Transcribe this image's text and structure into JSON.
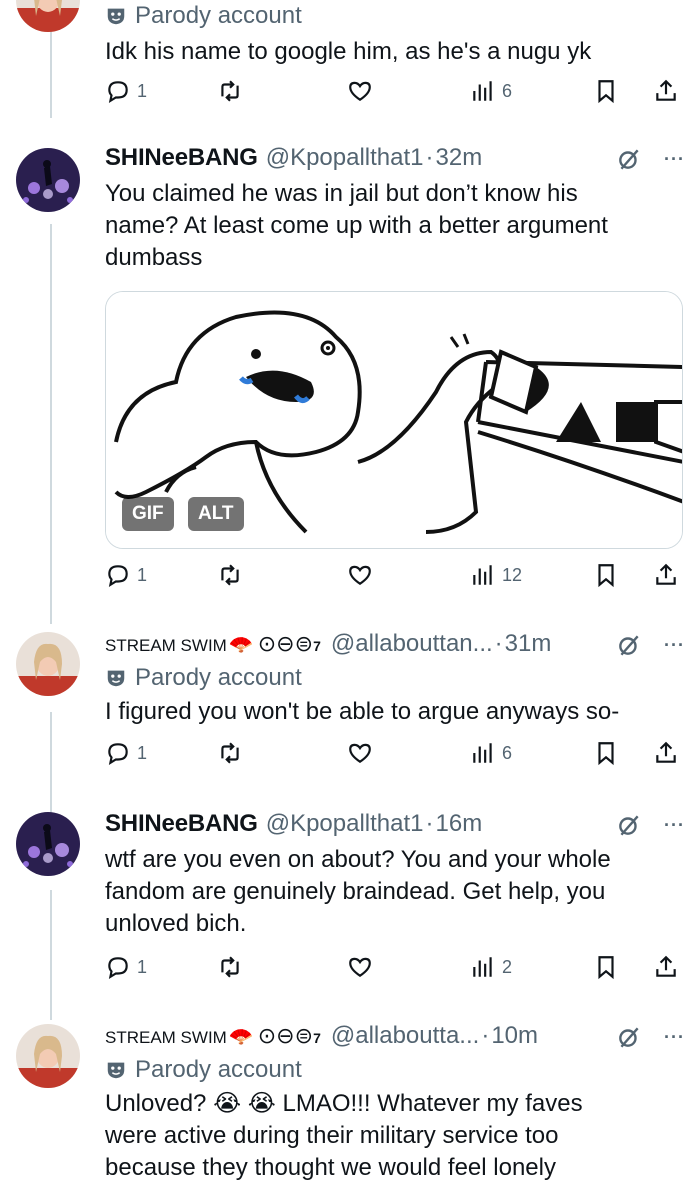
{
  "tweets": [
    {
      "parody_label": "Parody account",
      "text": "Idk his name to google him, as he's a nugu yk",
      "replies": "1",
      "retweets": "",
      "likes": "",
      "views": "6"
    },
    {
      "display_name": "SHINeeBANG",
      "handle": "@Kpopallthat1",
      "separator": "·",
      "time": "32m",
      "lines": [
        "You claimed he was in jail but don’t know his",
        "name? At least come up with a better argument",
        "dumbass"
      ],
      "media": {
        "gif_badge": "GIF",
        "alt_badge": "ALT"
      },
      "replies": "1",
      "retweets": "",
      "likes": "",
      "views": "12"
    },
    {
      "display_name": "STREAM SWIM",
      "fan_emoji": "🪭",
      "circles": "⊙⊖⊜",
      "superscript": "7",
      "handle": "@allabouttan...",
      "separator": "·",
      "time": "31m",
      "parody_label": "Parody account",
      "lines": [
        "I figured you won't be able to argue anyways so-"
      ],
      "replies": "1",
      "retweets": "",
      "likes": "",
      "views": "6"
    },
    {
      "display_name": "SHINeeBANG",
      "handle": "@Kpopallthat1",
      "separator": "·",
      "time": "16m",
      "lines": [
        "wtf are you even on about? You and your whole",
        "fandom are genuinely braindead. Get help, you",
        "unloved bich."
      ],
      "replies": "1",
      "retweets": "",
      "likes": "",
      "views": "2"
    },
    {
      "display_name": "STREAM SWIM",
      "fan_emoji": "🪭",
      "circles": "⊙⊖⊜",
      "superscript": "7",
      "handle": "@allaboutta...",
      "separator": "·",
      "time": "10m",
      "parody_label": "Parody account",
      "lines": [
        "Unloved? 😭 😭 LMAO!!! Whatever my faves",
        "were active during their military service too",
        "because they thought we would feel lonely"
      ],
      "replies": "",
      "retweets": "",
      "likes": "",
      "views": ""
    }
  ],
  "icons": {
    "reply": "reply-icon",
    "retweet": "retweet-icon",
    "like": "heart-icon",
    "views": "views-icon",
    "bookmark": "bookmark-icon",
    "share": "share-icon",
    "grok": "grok-icon",
    "more": "more-icon",
    "parody": "mask-icon"
  },
  "colors": {
    "text": "#0f1419",
    "secondary": "#536471",
    "border": "#cfd9de",
    "avatar_purple": "#2a1f4f",
    "avatar_red": "#c0392b"
  }
}
